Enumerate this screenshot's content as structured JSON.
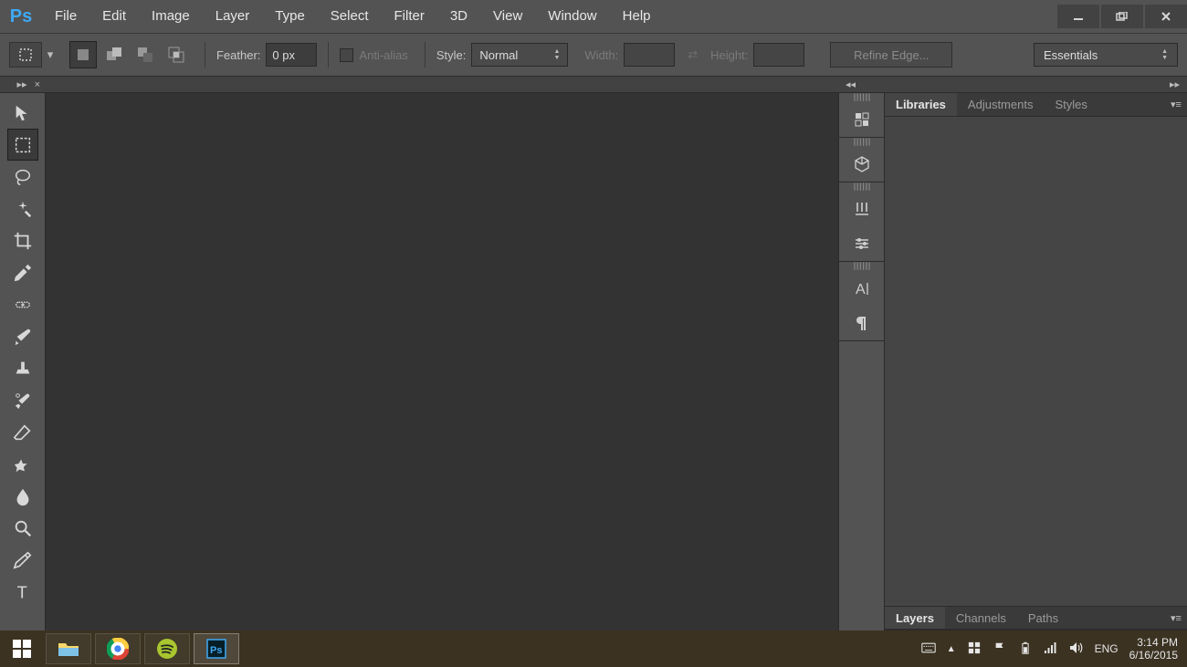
{
  "menubar": {
    "items": [
      "File",
      "Edit",
      "Image",
      "Layer",
      "Type",
      "Select",
      "Filter",
      "3D",
      "View",
      "Window",
      "Help"
    ],
    "logo": "Ps"
  },
  "options": {
    "feather_label": "Feather:",
    "feather_value": "0 px",
    "antialias_label": "Anti-alias",
    "style_label": "Style:",
    "style_value": "Normal",
    "width_label": "Width:",
    "height_label": "Height:",
    "refine_label": "Refine Edge...",
    "workspace": "Essentials"
  },
  "panel_group1": {
    "tabs": [
      "Libraries",
      "Adjustments",
      "Styles"
    ],
    "active": 0
  },
  "panel_group2": {
    "tabs": [
      "Layers",
      "Channels",
      "Paths"
    ],
    "active": 0
  },
  "tray": {
    "lang": "ENG",
    "time": "3:14 PM",
    "date": "6/16/2015"
  }
}
